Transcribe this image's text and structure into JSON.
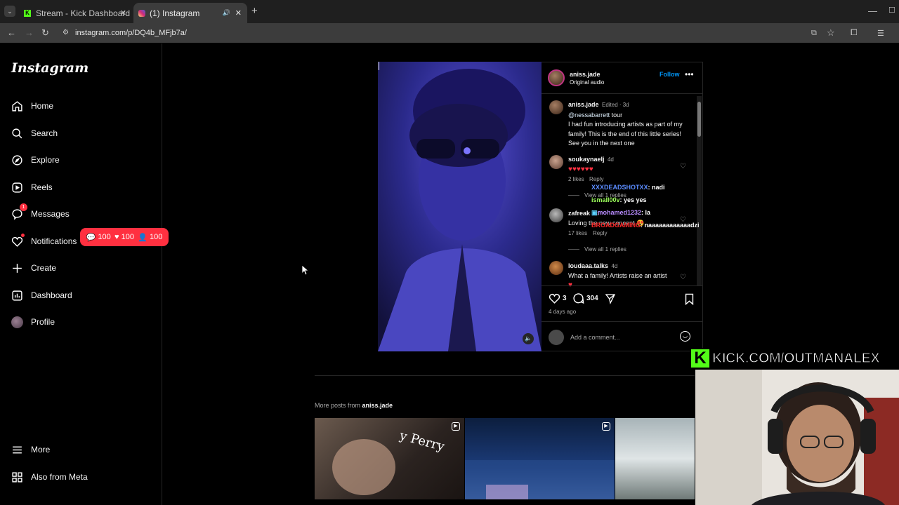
{
  "browser": {
    "tabs": [
      {
        "title": "Stream - Kick Dashboard",
        "active": false
      },
      {
        "title": "(1) Instagram",
        "active": true
      }
    ],
    "url": "instagram.com/p/DQ4b_MFjb7a/"
  },
  "sidebar": {
    "logo": "Instagram",
    "items": [
      {
        "label": "Home",
        "icon": "home-icon"
      },
      {
        "label": "Search",
        "icon": "search-icon"
      },
      {
        "label": "Explore",
        "icon": "compass-icon"
      },
      {
        "label": "Reels",
        "icon": "reels-icon"
      },
      {
        "label": "Messages",
        "icon": "messenger-icon",
        "badge": "1"
      },
      {
        "label": "Notifications",
        "icon": "heart-icon"
      },
      {
        "label": "Create",
        "icon": "plus-icon"
      },
      {
        "label": "Dashboard",
        "icon": "dashboard-icon"
      },
      {
        "label": "Profile",
        "icon": "avatar"
      }
    ],
    "bottom_items": [
      {
        "label": "More",
        "icon": "menu-icon"
      },
      {
        "label": "Also from Meta",
        "icon": "meta-icon"
      }
    ],
    "notif_pill": {
      "comments": "100",
      "likes": "100",
      "follows": "100"
    }
  },
  "post": {
    "header": {
      "username": "aniss.jade",
      "audio": "Original audio",
      "follow": "Follow"
    },
    "caption": {
      "username": "aniss.jade",
      "meta": "Edited · 3d",
      "mention": "@nessabarrett",
      "mention_rest": " tour",
      "text": "I had fun introducing artists as part of my family! This is the end of this little series! See you in the next one"
    },
    "comments": [
      {
        "username": "soukaynaelj",
        "time": "4d",
        "text": "♥♥♥♥♥♥",
        "likes": "2 likes",
        "reply": "Reply",
        "view_replies": "View all 1 replies"
      },
      {
        "username": "zafreak",
        "time": "4d",
        "text": "Loving the new concept 😍",
        "likes": "17 likes",
        "reply": "Reply",
        "view_replies": "View all 1 replies"
      },
      {
        "username": "loudaaa.talks",
        "time": "4d",
        "text": "What a family! Artists raise an artist",
        "text2": "♥"
      }
    ],
    "chat_overlay": [
      {
        "user": "XXXDEADSHOTXX",
        "msg": ": nadi",
        "color": "#5b8cff"
      },
      {
        "user": "ismall00v",
        "msg": ": yes yes",
        "color": "#9cff5b"
      },
      {
        "user": "mohamed1232",
        "msg": ": la",
        "color": "#b98cff"
      },
      {
        "user": "BROADGAMING",
        "msg": ": naaaaaaaaaaaadzi",
        "color": "#ff2b2b"
      }
    ],
    "actions": {
      "likes_count": "3",
      "comments_count": "304"
    },
    "date": "4 days ago",
    "add_comment_placeholder": "Add a comment..."
  },
  "more_posts": {
    "prefix": "More posts from ",
    "username": "aniss.jade"
  },
  "stream": {
    "banner": "KICK.COM/OUTMANALEX",
    "kick_letter": "K"
  }
}
